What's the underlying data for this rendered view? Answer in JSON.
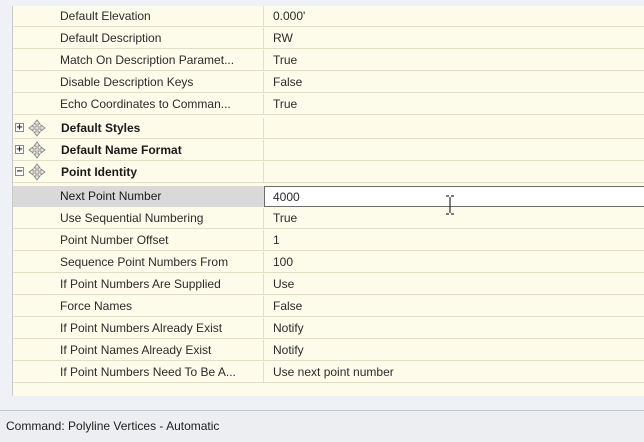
{
  "properties": {
    "rows": [
      {
        "name": "Default Elevation",
        "value": "0.000'"
      },
      {
        "name": "Default Description",
        "value": "RW"
      },
      {
        "name": "Match On Description Paramet...",
        "value": "True"
      },
      {
        "name": "Disable Description Keys",
        "value": "False"
      },
      {
        "name": "Echo Coordinates to Comman...",
        "value": "True"
      }
    ],
    "categories": {
      "default_styles": "Default Styles",
      "default_name_format": "Default Name Format",
      "point_identity": "Point Identity"
    },
    "point_identity_rows": [
      {
        "name": "Next Point Number",
        "value": "4000"
      },
      {
        "name": "Use Sequential Numbering",
        "value": "True"
      },
      {
        "name": "Point Number Offset",
        "value": "1"
      },
      {
        "name": "Sequence Point Numbers From",
        "value": "100"
      },
      {
        "name": "If Point Numbers Are Supplied",
        "value": "Use"
      },
      {
        "name": "Force Names",
        "value": "False"
      },
      {
        "name": "If Point Numbers Already Exist",
        "value": "Notify"
      },
      {
        "name": "If Point Names Already Exist",
        "value": "Notify"
      },
      {
        "name": "If Point Numbers Need To Be A...",
        "value": "Use next point number"
      }
    ],
    "expanders": {
      "collapsed": "+",
      "expanded": "−"
    }
  },
  "statusbar": {
    "text": "Command: Polyline Vertices - Automatic"
  },
  "icons": {
    "category": "move-cross-icon",
    "cursor": "text-cursor-icon"
  }
}
